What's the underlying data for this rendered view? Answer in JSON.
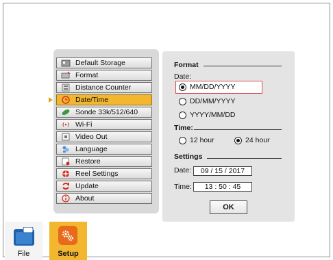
{
  "menu": {
    "items": [
      {
        "label": "Default Storage",
        "icon": "storage-icon"
      },
      {
        "label": "Format",
        "icon": "format-icon"
      },
      {
        "label": "Distance Counter",
        "icon": "distance-counter-icon"
      },
      {
        "label": "Date/Time",
        "icon": "clock-icon",
        "selected": true
      },
      {
        "label": "Sonde 33k/512/640",
        "icon": "sonde-icon"
      },
      {
        "label": "Wi-Fi",
        "icon": "wifi-icon"
      },
      {
        "label": "Video Out",
        "icon": "video-out-icon"
      },
      {
        "label": "Language",
        "icon": "language-icon"
      },
      {
        "label": "Restore",
        "icon": "restore-icon"
      },
      {
        "label": "Reel Settings",
        "icon": "reel-icon"
      },
      {
        "label": "Update",
        "icon": "update-icon"
      },
      {
        "label": "About",
        "icon": "info-icon"
      }
    ]
  },
  "format": {
    "heading": "Format",
    "date_label": "Date:",
    "options": [
      "MM/DD/YYYY",
      "DD/MM/YYYY",
      "YYYY/MM/DD"
    ],
    "selected": "MM/DD/YYYY"
  },
  "time": {
    "heading": "Time:",
    "options": [
      "12 hour",
      "24 hour"
    ],
    "selected": "24 hour"
  },
  "settings": {
    "heading": "Settings",
    "date_label": "Date:",
    "date_value": "09 / 15 / 2017",
    "time_label": "Time:",
    "time_value": "13 : 50 : 45"
  },
  "ok_label": "OK",
  "dock": {
    "file_label": "File",
    "setup_label": "Setup"
  },
  "colors": {
    "accent": "#f2b62f",
    "highlight_border": "#d94a4a",
    "panel": "#d9d9d9"
  }
}
